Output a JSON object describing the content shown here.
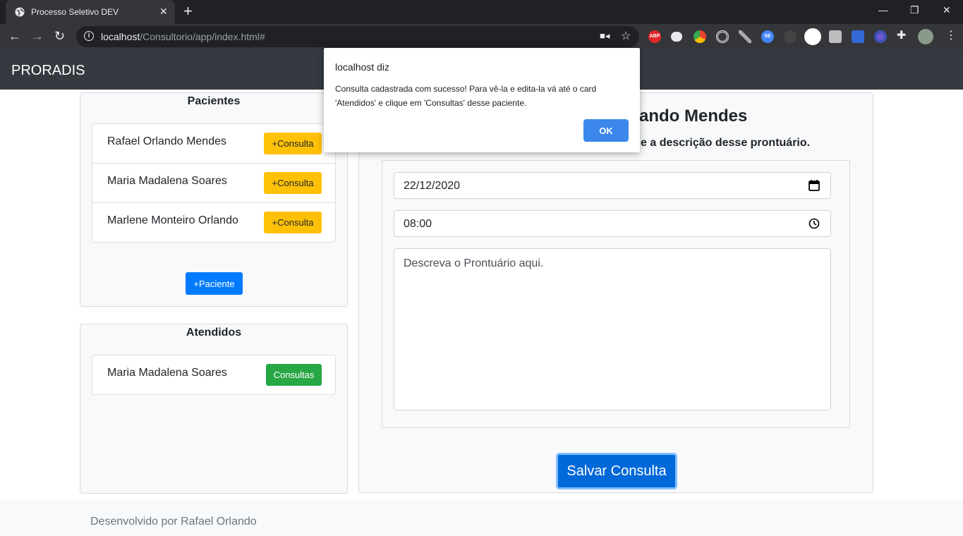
{
  "browser": {
    "tab_title": "Processo Seletivo DEV",
    "new_tab": "+",
    "url_host": "localhost",
    "url_path": "/Consultorio/app/index.html#",
    "extensions": [
      "abp-icon",
      "chat-icon",
      "chrome-color-icon",
      "target-icon",
      "pen-icon",
      "se-icon",
      "puzzle-dark-icon",
      "profile-circle-icon",
      "square-icon",
      "download-icon",
      "gear-blue-icon",
      "extensions-icon",
      "avatar-icon",
      "menu-icon"
    ],
    "ext_labels": {
      "abp": "ABP",
      "se": "SE"
    }
  },
  "app": {
    "brand": "PRORADIS"
  },
  "patients_card": {
    "title": "Pacientes",
    "items": [
      {
        "name": "Rafael Orlando Mendes",
        "button": "+Consulta"
      },
      {
        "name": "Maria Madalena Soares",
        "button": "+Consulta"
      },
      {
        "name": "Marlene Monteiro Orlando",
        "button": "+Consulta"
      }
    ],
    "add_button": "+Paciente"
  },
  "attended_card": {
    "title": "Atendidos",
    "items": [
      {
        "name": "Maria Madalena Soares",
        "button": "Consultas"
      }
    ]
  },
  "form": {
    "heading_visible": "ando Mendes",
    "subheading_visible": "e a descrição desse prontuário.",
    "date_value": "22/12/2020",
    "time_value": "08:00",
    "description_placeholder": "Descreva o Prontuário aqui.",
    "save_button": "Salvar Consulta"
  },
  "footer": {
    "text": "Desenvolvido por Rafael Orlando"
  },
  "dialog": {
    "title": "localhost diz",
    "message": "Consulta cadastrada com sucesso! Para vê-la e edita-la vá até o card 'Atendidos' e clique em 'Consultas' desse paciente.",
    "ok": "OK"
  },
  "colors": {
    "navbar": "#343a40",
    "warning": "#ffc107",
    "success": "#28a745",
    "primary": "#007bff",
    "dialog_ok": "#1a73e8"
  }
}
